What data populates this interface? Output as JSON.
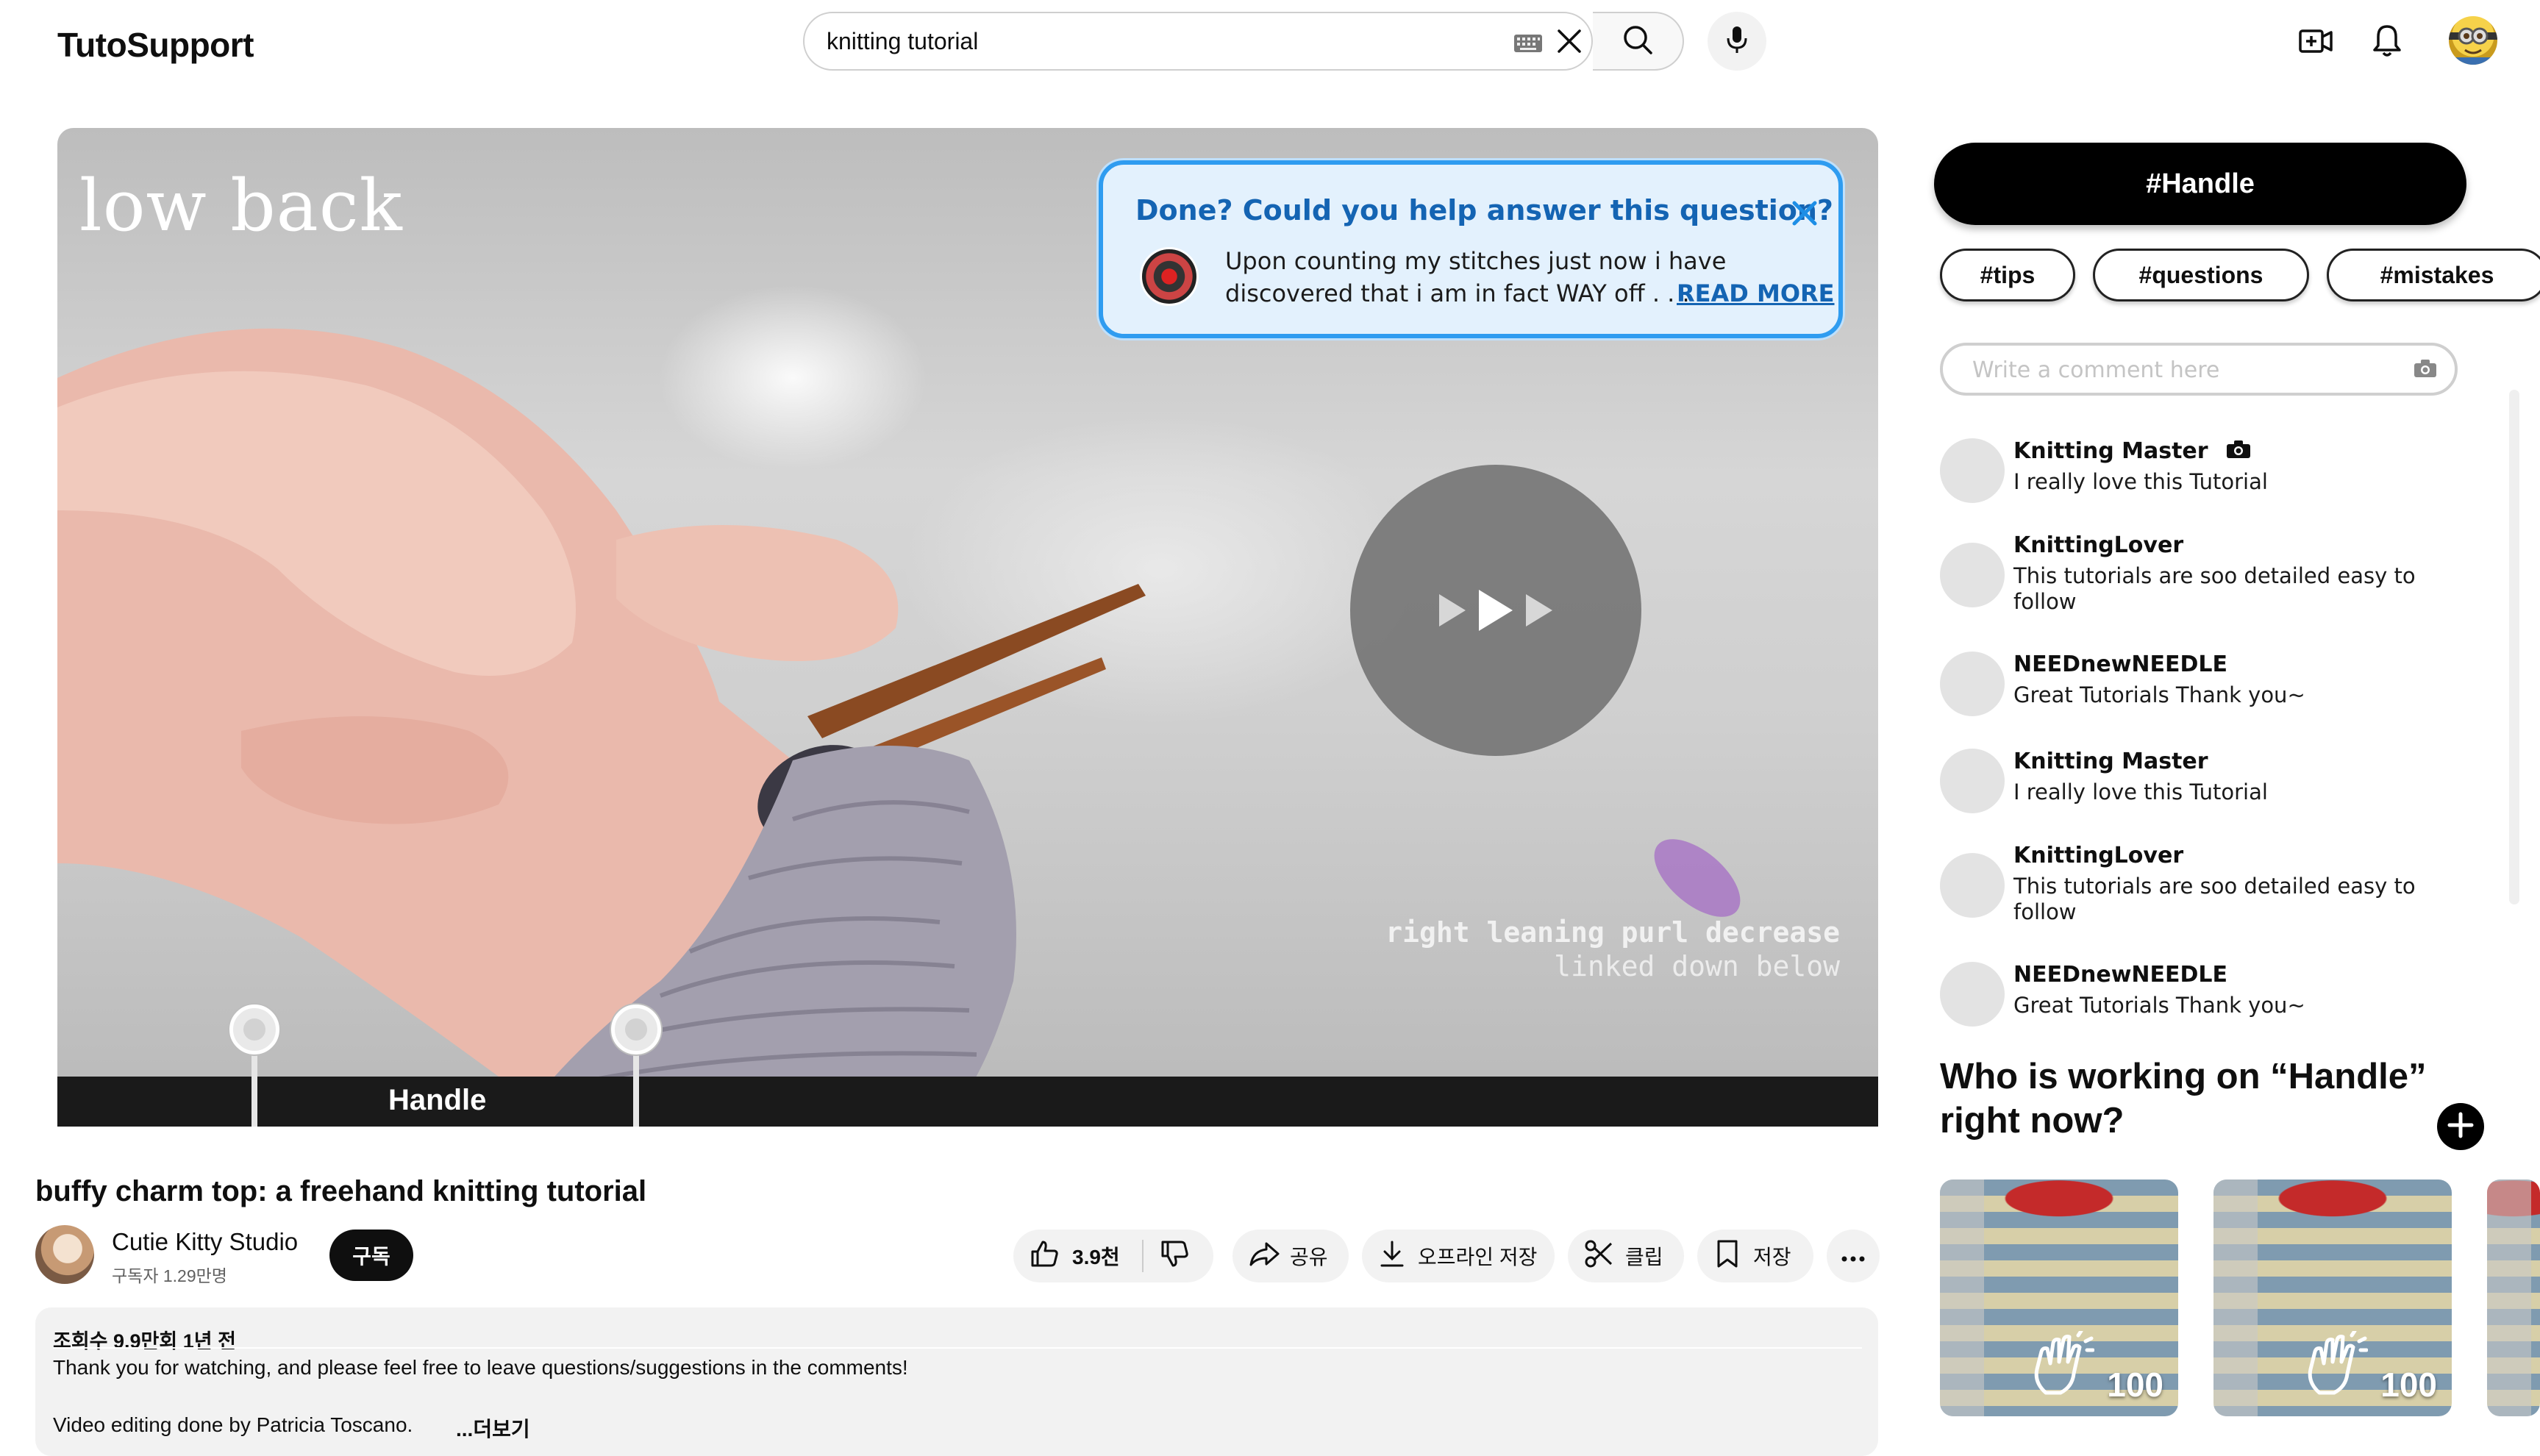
{
  "app": {
    "logo": "TutoSupport"
  },
  "search": {
    "value": "knitting tutorial"
  },
  "video": {
    "overlay_title": "low back",
    "captions": [
      "right leaning purl decrease",
      "linked down below"
    ],
    "timeline_label": "Handle"
  },
  "question_popup": {
    "title": "Done? Could you help answer this question?",
    "text_line_1": "Upon counting my stitches just now i have",
    "text_line_2": "discovered that i am in fact WAY off . . .",
    "read_more": "READ MORE"
  },
  "details": {
    "title": "buffy charm top: a freehand knitting tutorial",
    "channel_name": "Cutie Kitty Studio",
    "subscribers": "구독자 1.29만명",
    "subscribe_label": "구독",
    "like_count": "3.9천",
    "share_label": "공유",
    "download_label": "오프라인 저장",
    "clip_label": "클립",
    "save_label": "저장",
    "meta": "조회수 9.9만회  1년 전",
    "description_line_1": "Thank you for watching, and please feel free to leave questions/suggestions in the comments!",
    "description_line_2": "Video editing done by Patricia Toscano.",
    "more_label": "...더보기"
  },
  "side_panel": {
    "handle_tag": "#Handle",
    "tags": [
      "#tips",
      "#questions",
      "#mistakes"
    ],
    "comment_placeholder": "Write a comment here",
    "comments": [
      {
        "name": "Knitting Master",
        "text": "I really love this Tutorial",
        "camera": true
      },
      {
        "name": "KnittingLover",
        "text": "This tutorials are soo detailed easy to follow"
      },
      {
        "name": "NEEDnewNEEDLE",
        "text": "Great Tutorials Thank you~"
      },
      {
        "name": "Knitting Master",
        "text": "I really love this Tutorial"
      },
      {
        "name": "KnittingLover",
        "text": "This tutorials are soo detailed easy to follow"
      },
      {
        "name": "NEEDnewNEEDLE",
        "text": "Great Tutorials Thank you~"
      }
    ],
    "working_title": "Who is working on “Handle” right now?",
    "working_cards": [
      {
        "count": "100"
      },
      {
        "count": "100"
      }
    ]
  },
  "icons": {
    "keyboard": "keyboard-icon",
    "clear": "close-icon",
    "search": "search-icon",
    "mic": "microphone-icon",
    "create": "create-video-icon",
    "bell": "bell-icon",
    "like": "thumbs-up-icon",
    "dislike": "thumbs-down-icon",
    "share": "share-icon",
    "download": "download-icon",
    "clip": "scissors-icon",
    "save": "bookmark-icon",
    "more": "more-horizontal-icon",
    "camera": "camera-icon",
    "add": "plus-icon",
    "clap": "clap-icon"
  },
  "colors": {
    "accent_blue": "#1464b3",
    "popup_border": "#2f9cf0",
    "popup_bg": "#e3f1fd",
    "tag_black": "#000000"
  }
}
